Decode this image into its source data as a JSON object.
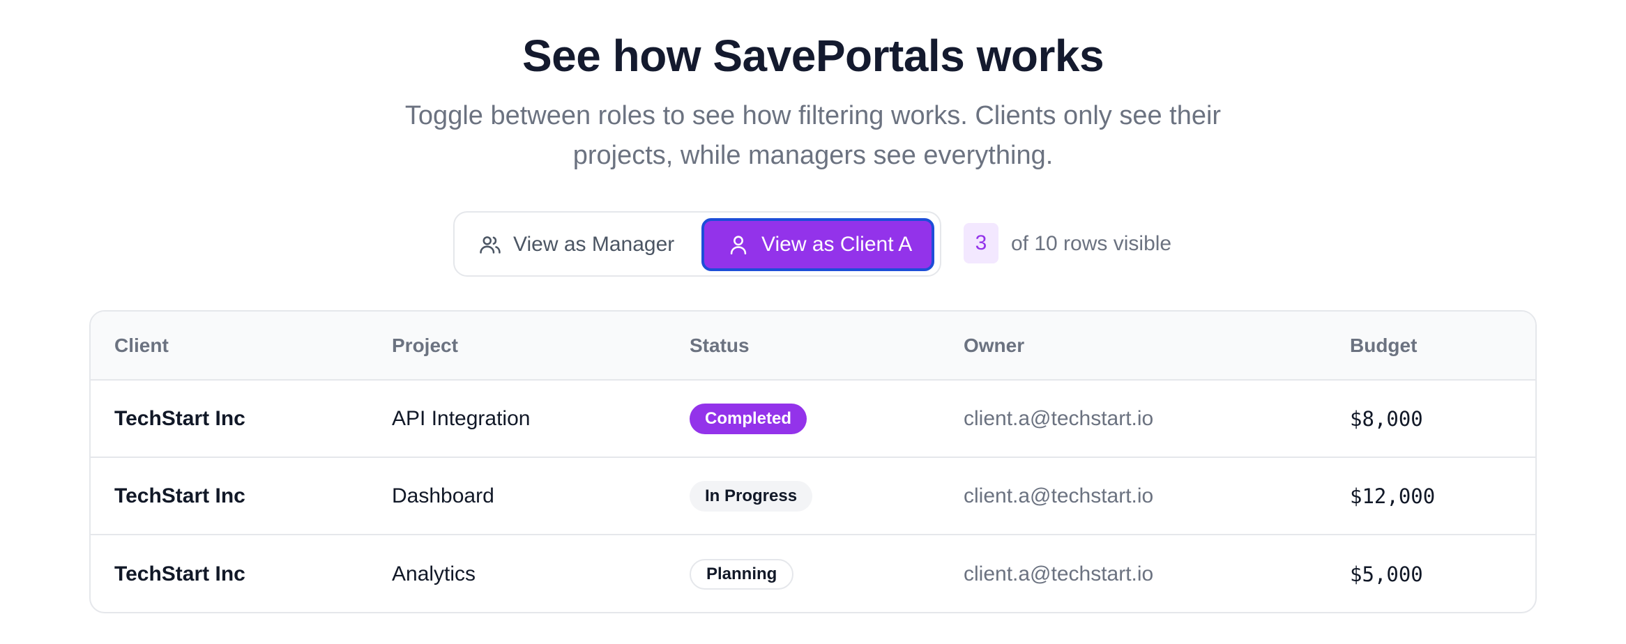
{
  "hero": {
    "title": "See how SavePortals works",
    "subtitle": "Toggle between roles to see how filtering works. Clients only see their projects, while managers see everything."
  },
  "role_toggle": {
    "manager_label": "View as Manager",
    "manager_icon": "users-icon",
    "client_label": "View as Client A",
    "client_icon": "user-icon",
    "active": "client"
  },
  "visibility": {
    "count": "3",
    "text": "of 10 rows visible"
  },
  "table": {
    "headers": [
      "Client",
      "Project",
      "Status",
      "Owner",
      "Budget"
    ],
    "rows": [
      {
        "client": "TechStart Inc",
        "project": "API Integration",
        "status": "Completed",
        "owner": "client.a@techstart.io",
        "budget": "$8,000"
      },
      {
        "client": "TechStart Inc",
        "project": "Dashboard",
        "status": "In Progress",
        "owner": "client.a@techstart.io",
        "budget": "$12,000"
      },
      {
        "client": "TechStart Inc",
        "project": "Analytics",
        "status": "Planning",
        "owner": "client.a@techstart.io",
        "budget": "$5,000"
      }
    ]
  },
  "colors": {
    "accent": "#9333ea",
    "accent_light": "#f3e8ff",
    "focus_ring": "#1d4ed8",
    "title": "#141a2e",
    "muted": "#6b7280"
  }
}
